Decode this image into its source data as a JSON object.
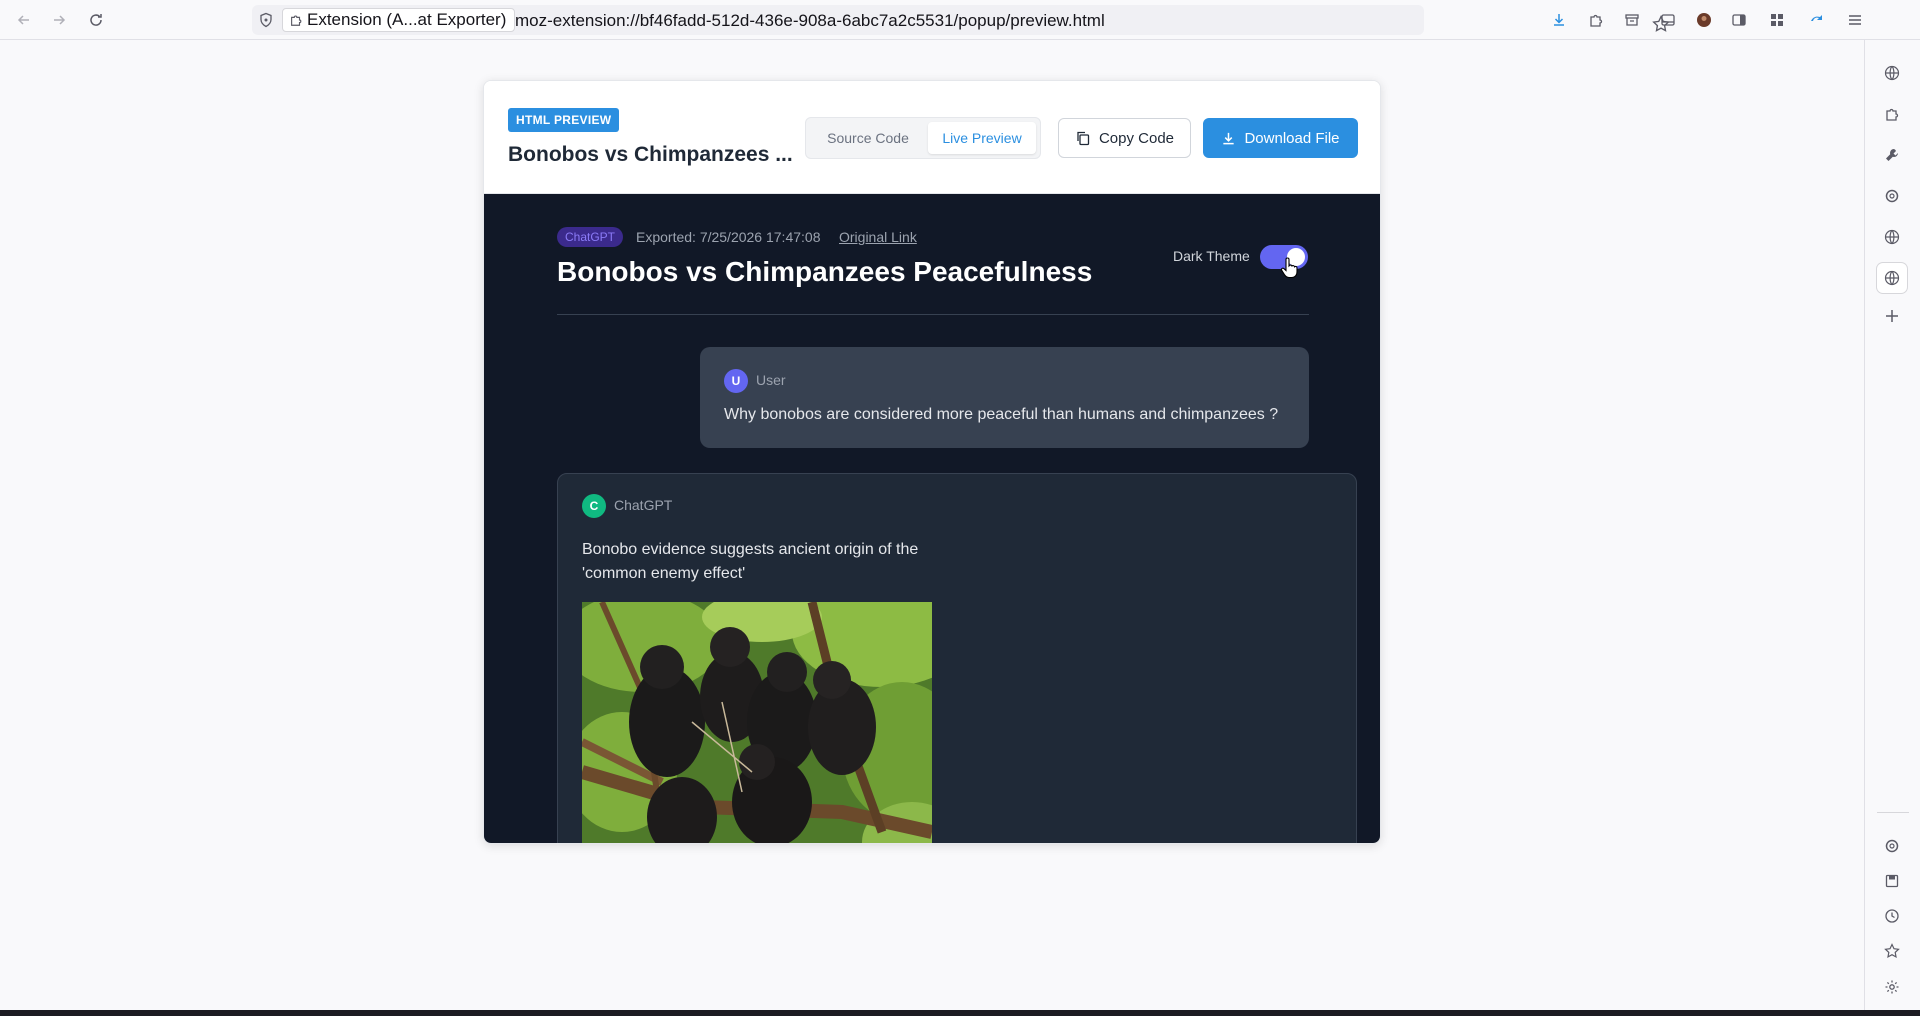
{
  "browser": {
    "tab_identity": "Extension (A...at Exporter)",
    "url": "moz-extension://bf46fadd-512d-436e-908a-6abc7a2c5531/popup/preview.html"
  },
  "header": {
    "badge": "HTML PREVIEW",
    "title": "Bonobos vs Chimpanzees ...",
    "tabs": {
      "source": "Source Code",
      "live": "Live Preview",
      "active": "live"
    },
    "copy_label": "Copy Code",
    "download_label": "Download File"
  },
  "preview": {
    "source_badge": "ChatGPT",
    "exported": "Exported: 7/25/2026 17:47:08",
    "original_link": "Original Link",
    "title": "Bonobos vs Chimpanzees Peacefulness",
    "dark_theme_label": "Dark Theme",
    "dark_theme_on": true,
    "messages": [
      {
        "role": "User",
        "avatar": "U",
        "text": "Why bonobos are considered more peaceful than humans and chimpanzees ?"
      },
      {
        "role": "ChatGPT",
        "avatar": "C",
        "text": "Bonobo evidence suggests ancient origin of the 'common enemy effect'",
        "image": "bonobo-group-photo"
      }
    ]
  },
  "colors": {
    "accent": "#2b8fe0",
    "toggle": "#6366f1",
    "user_avatar": "#6366f1",
    "bot_avatar": "#10b981",
    "preview_bg": "#111827"
  }
}
